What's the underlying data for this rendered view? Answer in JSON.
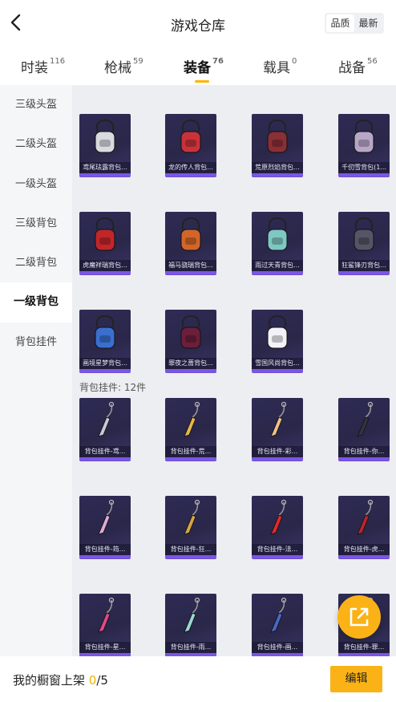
{
  "header": {
    "title": "游戏仓库",
    "sort_options": [
      "品质",
      "最新"
    ],
    "sort_active": 0
  },
  "tabs": [
    {
      "label": "时装",
      "count": "116"
    },
    {
      "label": "枪械",
      "count": "59"
    },
    {
      "label": "装备",
      "count": "76"
    },
    {
      "label": "载具",
      "count": "0"
    },
    {
      "label": "战备",
      "count": "56"
    }
  ],
  "active_tab": 2,
  "sidebar": {
    "items": [
      "三级头盔",
      "二级头盔",
      "一级头盔",
      "三级背包",
      "二级背包",
      "一级背包",
      "背包挂件"
    ],
    "active": 5
  },
  "section": {
    "label": "背包挂件: 12件"
  },
  "backpacks": [
    {
      "name": "鸢尾珐露背包...",
      "icon": "backpack-icon",
      "color": "#d9d9e0"
    },
    {
      "name": "龙的传人背包...",
      "icon": "backpack-icon",
      "color": "#c8323a"
    },
    {
      "name": "荒原烈焰背包...",
      "icon": "backpack-icon",
      "color": "#8a2f36"
    },
    {
      "name": "千仞雪背包(1...",
      "icon": "backpack-icon",
      "color": "#b8a6c8"
    },
    {
      "name": "虎魔祥瑞背包...",
      "icon": "backpack-icon",
      "color": "#c0262a"
    },
    {
      "name": "福马骁瑞背包...",
      "icon": "backpack-icon",
      "color": "#d2662a"
    },
    {
      "name": "雨过天青背包...",
      "icon": "backpack-icon",
      "color": "#7fc7c2"
    },
    {
      "name": "狂鲨锋刃背包...",
      "icon": "backpack-icon",
      "color": "#555566"
    },
    {
      "name": "画境星梦背包...",
      "icon": "backpack-icon",
      "color": "#3a6fd0"
    },
    {
      "name": "罪夜之蔷背包...",
      "icon": "backpack-icon",
      "color": "#6a1f3a"
    },
    {
      "name": "雪国风尚背包...",
      "icon": "backpack-icon",
      "color": "#f2f2f8"
    }
  ],
  "pendants": [
    {
      "name": "背包挂件-鸢...",
      "icon": "pendant-icon",
      "color": "#c9c9d6"
    },
    {
      "name": "背包挂件-荒...",
      "icon": "pendant-icon",
      "color": "#e6b84a"
    },
    {
      "name": "背包挂件-彩...",
      "icon": "pendant-icon",
      "color": "#f0c08a"
    },
    {
      "name": "背包挂件-你...",
      "icon": "pendant-icon",
      "color": "#333340"
    },
    {
      "name": "背包挂件-筠...",
      "icon": "pendant-icon",
      "color": "#e0a8d8"
    },
    {
      "name": "背包挂件-狂...",
      "icon": "pendant-icon",
      "color": "#d9a440"
    },
    {
      "name": "背包挂件-法...",
      "icon": "pendant-icon",
      "color": "#e02a2a"
    },
    {
      "name": "背包挂件-虎...",
      "icon": "pendant-icon",
      "color": "#b8262a"
    },
    {
      "name": "背包挂件-星...",
      "icon": "pendant-icon",
      "color": "#e04a8a"
    },
    {
      "name": "背包挂件-雨...",
      "icon": "pendant-icon",
      "color": "#9ad8d2"
    },
    {
      "name": "背包挂件-画...",
      "icon": "pendant-icon",
      "color": "#4a68c8"
    },
    {
      "name": "背包挂件-罪...",
      "icon": "pendant-icon",
      "color": "#5a2438"
    }
  ],
  "bottom": {
    "label": "我的橱窗上架 ",
    "current": "0",
    "total": "/5",
    "edit_label": "编辑"
  },
  "colors": {
    "accent": "#fbb217",
    "card_bg": "#2b2850",
    "card_stripe": "#7a56e6"
  }
}
